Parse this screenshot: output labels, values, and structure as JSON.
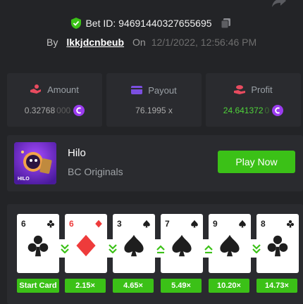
{
  "header": {
    "bet_label": "Bet ID: 94691440327655695",
    "by_label": "By",
    "username": "lkkjdcnbeub",
    "on_label": "On",
    "datetime": "12/1/2022, 12:56:46 PM"
  },
  "stats": {
    "amount": {
      "label": "Amount",
      "value_main": "0.32768",
      "value_dim": "000"
    },
    "payout": {
      "label": "Payout",
      "value": "76.1995 x"
    },
    "profit": {
      "label": "Profit",
      "value_main": "24.641372",
      "value_dim": "0"
    }
  },
  "game": {
    "title": "Hilo",
    "provider": "BC Originals",
    "thumb_text": "HILO",
    "play_label": "Play Now"
  },
  "cards": [
    {
      "rank": "6",
      "suit": "clubs",
      "color": "black",
      "label": "Start Card"
    },
    {
      "rank": "6",
      "suit": "diamonds",
      "color": "red",
      "label": "2.15×",
      "arrow_before": "down"
    },
    {
      "rank": "3",
      "suit": "spades",
      "color": "black",
      "label": "4.65×",
      "arrow_before": "down"
    },
    {
      "rank": "7",
      "suit": "spades",
      "color": "black",
      "label": "5.49×",
      "arrow_before": "up"
    },
    {
      "rank": "9",
      "suit": "spades",
      "color": "black",
      "label": "10.20×",
      "arrow_before": "up"
    },
    {
      "rank": "8",
      "suit": "clubs",
      "color": "black",
      "label": "14.73×",
      "arrow_before": "down"
    }
  ],
  "colors": {
    "background": "#232427",
    "panel": "#2a2b2f",
    "accent_green": "#3bc117",
    "profit_green": "#4fd23a",
    "card_red": "#ee3b3b"
  },
  "icons": {
    "share": "share-icon",
    "verified": "shield-check-icon",
    "copy": "copy-icon",
    "amount": "hand-coins-icon",
    "payout": "card-icon",
    "profit": "hand-money-icon",
    "coin": "currency-coin-icon"
  }
}
